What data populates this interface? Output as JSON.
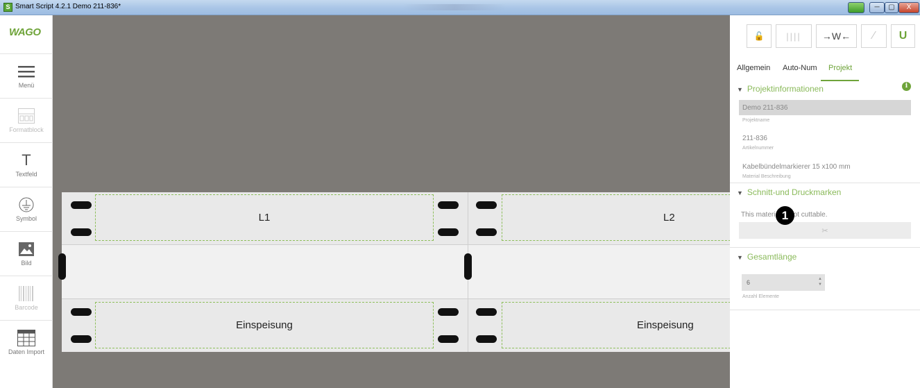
{
  "window": {
    "title": "Smart Script 4.2.1  Demo 211-836*",
    "app_icon_glyph": "S",
    "min_glyph": "─",
    "max_glyph": "▢",
    "close_glyph": "X"
  },
  "sidebar": {
    "logo": "WAGO",
    "items": [
      {
        "label": "Menü",
        "icon": "menu-icon",
        "enabled": true
      },
      {
        "label": "Formatblock",
        "icon": "formatblock-icon",
        "enabled": false
      },
      {
        "label": "Textfeld",
        "icon": "text-icon",
        "glyph": "T",
        "enabled": true
      },
      {
        "label": "Symbol",
        "icon": "ground-symbol-icon",
        "enabled": true
      },
      {
        "label": "Bild",
        "icon": "image-icon",
        "enabled": true
      },
      {
        "label": "Barcode",
        "icon": "barcode-icon",
        "enabled": false
      },
      {
        "label": "Daten Import",
        "icon": "table-import-icon",
        "enabled": true
      }
    ]
  },
  "canvas": {
    "labels": {
      "top_left": "L1",
      "top_right": "L2",
      "bottom_left": "Einspeisung",
      "bottom_right": "Einspeisung"
    }
  },
  "panel": {
    "toolbar": [
      {
        "icon": "unlock-icon",
        "glyph": "🔓"
      },
      {
        "icon": "columns-icon",
        "glyph": "||||"
      },
      {
        "icon": "fit-width-icon",
        "glyph": "→W←"
      },
      {
        "icon": "magic-wand-icon",
        "glyph": "⁄"
      },
      {
        "icon": "magnet-icon",
        "glyph": "U"
      }
    ],
    "tabs": [
      {
        "label": "Allgemein",
        "active": false
      },
      {
        "label": "Auto-Num",
        "active": false
      },
      {
        "label": "Projekt",
        "active": true
      }
    ],
    "sections": {
      "projektinformationen": {
        "title": "Projektinformationen",
        "info_glyph": "i",
        "fields": [
          {
            "value": "Demo 211-836",
            "caption": "Projektname"
          },
          {
            "value": "211-836",
            "caption": "Artikelnummer"
          },
          {
            "value": "Kabelbündelmarkierer 15 x100 mm",
            "caption": "Material Beschreibung"
          }
        ]
      },
      "schnitt": {
        "title": "Schnitt-und Druckmarken",
        "message": "This material is not cuttable.",
        "cut_glyph": "✂"
      },
      "gesamtlaenge": {
        "title": "Gesamtlänge",
        "count_value": "6",
        "count_caption": "Anzahl Elemente",
        "spin_up": "▲",
        "spin_down": "▼"
      }
    },
    "chevron": "▼",
    "callout_badge": "1"
  },
  "colors": {
    "accent": "#6fa43a",
    "canvas_bg": "#7d7a76",
    "section_title": "#8aba5a"
  }
}
